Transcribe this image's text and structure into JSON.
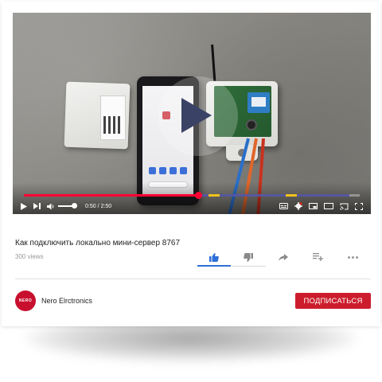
{
  "colors": {
    "progress_played": "#ff0033",
    "progress_buffer": "#5050a0",
    "chapter_marker": "#f2c21b",
    "like_active": "#2f6fd8",
    "subscribe_bg": "#cc1d2c",
    "avatar_bg": "#c8102e"
  },
  "player": {
    "playback_progress": 0.52,
    "buffered_to": 0.97,
    "chapter_markers": [
      0.55,
      0.78
    ],
    "volume_level": 0.85,
    "time": {
      "current": "0:50",
      "separator": "/",
      "duration": "2:50"
    },
    "controls_left": [
      "play-icon",
      "next-icon",
      "volume-icon"
    ],
    "controls_right": [
      "subtitles-icon",
      "settings-icon",
      "miniplayer-icon",
      "theater-icon",
      "cast-icon",
      "fullscreen-icon"
    ]
  },
  "video": {
    "title": "Как подключить локально мини-сервер 8767",
    "views": "300 views"
  },
  "actions": [
    {
      "name": "like-icon",
      "active": true
    },
    {
      "name": "dislike-icon",
      "active": false
    },
    {
      "name": "share-icon",
      "active": false
    },
    {
      "name": "save-to-playlist-icon",
      "active": false
    },
    {
      "name": "more-icon",
      "active": false
    }
  ],
  "channel": {
    "avatar_text": "NERO",
    "name": "Nero Elrctronics",
    "subscribe_label": "ПОДПИСАТЬСЯ"
  }
}
